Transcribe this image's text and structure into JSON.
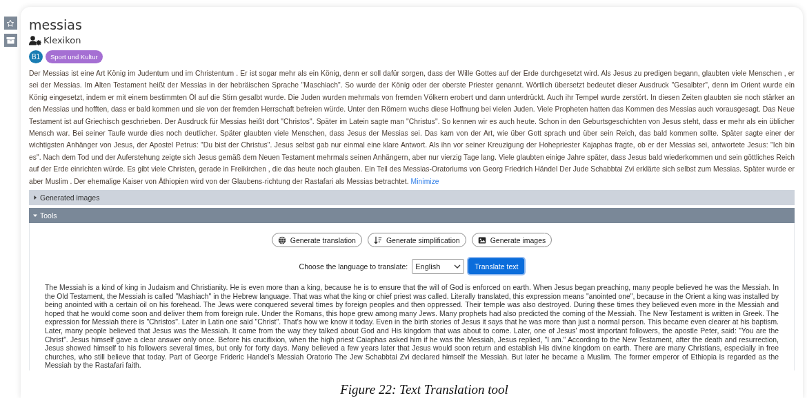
{
  "title": "messias",
  "source": "Klexikon",
  "badges": [
    {
      "text": "B1",
      "kind": "level",
      "color": "#1a7db3"
    },
    {
      "text": "Sport und Kultur",
      "kind": "category",
      "color": "#a56fd3"
    }
  ],
  "article": {
    "text": "Der Messias ist eine Art König im Judentum und im Christentum . Er ist sogar mehr als ein König, denn er soll dafür sorgen, dass der Wille Gottes auf der Erde durchgesetzt wird. Als Jesus zu predigen begann, glaubten viele Menschen , er sei der Messias. Im Alten Testament heißt der Messias in der hebräischen Sprache \"Maschiach\". So wurde der König oder der oberste Priester genannt. Wörtlich übersetzt bedeutet dieser Ausdruck \"Gesalbter\", denn im Orient wurde ein König eingesetzt, indem er mit einem bestimmten Öl auf die Stirn gesalbt wurde. Die Juden wurden mehrmals von fremden Völkern erobert und dann unterdrückt. Auch ihr Tempel wurde zerstört. In diesen Zeiten glaubten sie noch stärker an den Messias und hofften, dass er bald kommen und sie von der fremden Herrschaft befreien würde. Unter den Römern wuchs diese Hoffnung bei vielen Juden. Viele Propheten hatten das Kommen des Messias auch vorausgesagt. Das Neue Testament ist auf Griechisch geschrieben. Der Ausdruck für Messias heißt dort \"Christos\". Später im Latein sagte man \"Christus\". So kennen wir es auch heute. Schon in den Geburtsgeschichten von Jesus steht, dass er mehr als ein üblicher Mensch war. Bei seiner Taufe wurde dies noch deutlicher. Später glaubten viele Menschen, dass Jesus der Messias sei. Das kam von der Art, wie über Gott sprach und über sein Reich, das bald kommen sollte. Später sagte einer der wichtigsten Anhänger von Jesus, der Apostel Petrus: \"Du bist der Christus\". Jesus selbst gab nur einmal eine klare Antwort. Als ihn vor seiner Kreuzigung der Hohepriester Kajaphas fragte, ob er der Messias sei, antwortete Jesus: \"Ich bin es\". Nach dem Tod und der Auferstehung zeigte sich Jesus gemäß dem Neuen Testament mehrmals seinen Anhängern, aber nur vierzig Tage lang. Viele glaubten einige Jahre später, dass Jesus bald wiederkommen und sein göttliches Reich auf der Erde einrichten würde. Es gibt viele Christen, gerade in Freikirchen , die das heute noch glauben. Ein Teil des Messias-Oratoriums von Georg Friedrich Händel Der Jude Schabbtai Zvi erklärte sich selbst zum Messias. Später wurde er aber Muslim . Der ehemalige Kaiser von Äthiopien wird von der Glaubens-richtung der Rastafari als Messias betrachtet.",
    "toggle": "Minimize"
  },
  "sections": [
    {
      "title": "Generated images",
      "expanded": false
    },
    {
      "title": "Tools",
      "expanded": true,
      "actions": [
        "Generate translation",
        "Generate simplification",
        "Generate images"
      ],
      "language_label": "Choose the language to translate:",
      "language": "English",
      "submit": "Translate text",
      "output": "The Messiah is a kind of king in Judaism and Christianity. He is even more than a king, because he is to ensure that the will of God is enforced on earth. When Jesus began preaching, many people believed he was the Messiah. In the Old Testament, the Messiah is called \"Mashiach\" in the Hebrew language. That was what the king or chief priest was called. Literally translated, this expression means \"anointed one\", because in the Orient a king was installed by being anointed with a certain oil on his forehead. The Jews were conquered several times by foreign peoples and then oppressed. Their temple was also destroyed. During these times they believed even more in the Messiah and hoped that he would come soon and deliver them from foreign rule. Under the Romans, this hope grew among many Jews. Many prophets had also predicted the coming of the Messiah. The New Testament is written in Greek. The expression for Messiah there is \"Christos\". Later in Latin one said \"Christ\". That's how we know it today. Even in the birth stories of Jesus it says that he was more than just a normal person. This became even clearer at his baptism. Later, many people believed that Jesus was the Messiah. It came from the way they talked about God and His kingdom that was about to come. Later, one of Jesus' most important followers, the apostle Peter, said: \"You are the Christ\". Jesus himself gave a clear answer only once. Before his crucifixion, when the high priest Caiaphas asked him if he was the Messiah, Jesus replied, \"I am.\" According to the New Testament, after the death and resurrection, Jesus showed himself to his followers several times, but only for forty days. Many believed a few years later that Jesus would soon return and establish His divine kingdom on earth. There are many Christians, especially in free churches, who still believe that today. Part of George Frideric Handel's Messiah Oratorio The Jew Schabbtai Zvi declared himself the Messiah. But later he became a Muslim. The former emperor of Ethiopia is regarded as the Messiah by the Rastafari faith."
    }
  ],
  "caption": "Figure 22: Text Translation tool"
}
